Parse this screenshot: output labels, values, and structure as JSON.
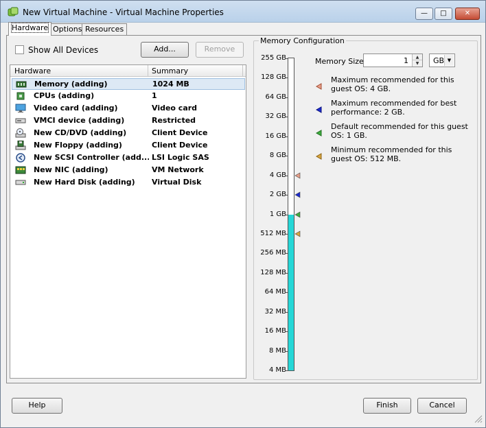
{
  "window": {
    "title": "New Virtual Machine - Virtual Machine Properties",
    "controls": {
      "minimize": "—",
      "maximize": "□",
      "close": "✕"
    }
  },
  "tabs": [
    {
      "label": "Hardware",
      "active": true
    },
    {
      "label": "Options",
      "active": false
    },
    {
      "label": "Resources",
      "active": false
    }
  ],
  "hardware_panel": {
    "show_all_devices_label": "Show All Devices",
    "show_all_devices_checked": false,
    "add_button": "Add...",
    "remove_button": "Remove",
    "columns": [
      "Hardware",
      "Summary"
    ],
    "rows": [
      {
        "icon": "memory-icon",
        "name": "Memory (adding)",
        "summary": "1024 MB",
        "selected": true
      },
      {
        "icon": "cpu-icon",
        "name": "CPUs (adding)",
        "summary": "1",
        "selected": false
      },
      {
        "icon": "monitor-icon",
        "name": "Video card  (adding)",
        "summary": "Video card",
        "selected": false
      },
      {
        "icon": "vmci-icon",
        "name": "VMCI device (adding)",
        "summary": "Restricted",
        "selected": false
      },
      {
        "icon": "cd-dvd-icon",
        "name": "New CD/DVD (adding)",
        "summary": "Client Device",
        "selected": false
      },
      {
        "icon": "floppy-icon",
        "name": "New Floppy (adding)",
        "summary": "Client Device",
        "selected": false
      },
      {
        "icon": "scsi-icon",
        "name": "New SCSI Controller (add...",
        "summary": "LSI Logic SAS",
        "selected": false
      },
      {
        "icon": "nic-icon",
        "name": "New NIC (adding)",
        "summary": "VM Network",
        "selected": false
      },
      {
        "icon": "hard-disk-icon",
        "name": "New Hard Disk (adding)",
        "summary": "Virtual Disk",
        "selected": false
      }
    ]
  },
  "memory_config": {
    "group_label": "Memory Configuration",
    "memory_size_label": "Memory Size:",
    "memory_size_value": "1",
    "unit": "GB",
    "scale_labels": [
      "255 GB",
      "128 GB",
      "64 GB",
      "32 GB",
      "16 GB",
      "8 GB",
      "4 GB",
      "2 GB",
      "1 GB",
      "512 MB",
      "256 MB",
      "128 MB",
      "64 MB",
      "32 MB",
      "16 MB",
      "8 MB",
      "4 MB"
    ],
    "current_level_label": "1 GB",
    "legend": [
      {
        "color": "#e8a08a",
        "marker_at": "4 GB",
        "text": "Maximum recommended for this guest OS: 4 GB."
      },
      {
        "color": "#1c2bd0",
        "marker_at": "2 GB",
        "text": "Maximum recommended for best performance: 2 GB."
      },
      {
        "color": "#3fae3f",
        "marker_at": "1 GB",
        "text": "Default recommended for this guest OS: 1 GB."
      },
      {
        "color": "#d8a640",
        "marker_at": "512 MB",
        "text": "Minimum recommended for this guest OS: 512 MB."
      }
    ]
  },
  "footer": {
    "help_button": "Help",
    "finish_button": "Finish",
    "cancel_button": "Cancel"
  },
  "colors": {
    "scale_fill": "#25d7d7",
    "selection": "#dde9f5"
  }
}
